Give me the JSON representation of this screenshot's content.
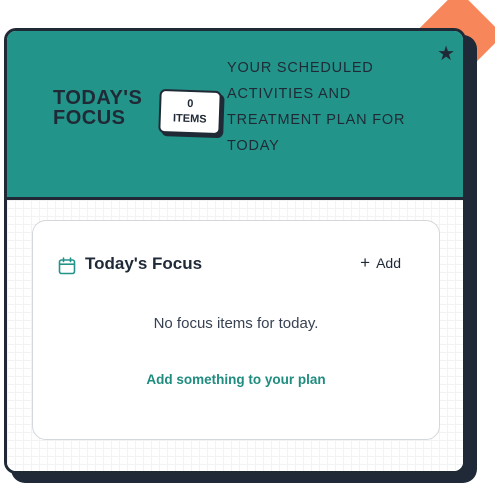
{
  "header": {
    "title_line1": "TODAY'S",
    "title_line2": "FOCUS",
    "badge_count": "0",
    "badge_unit": "ITEMS",
    "subtitle": "YOUR SCHEDULED ACTIVITIES AND TREATMENT PLAN FOR TODAY",
    "star_glyph": "★"
  },
  "panel": {
    "icon": "calendar-icon",
    "title": "Today's Focus",
    "add_plus": "+",
    "add_label": "Add",
    "empty_message": "No focus items for today.",
    "add_link": "Add something to your plan"
  },
  "colors": {
    "header_bg": "#23948a",
    "accent": "#f7875a",
    "ink": "#202a36",
    "link": "#1f8c7f"
  }
}
